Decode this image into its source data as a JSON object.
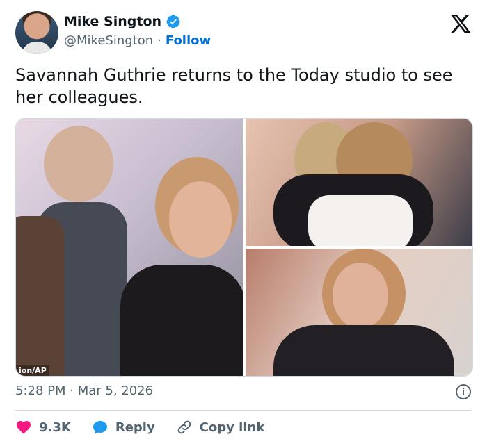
{
  "author": {
    "name": "Mike Sington",
    "handle": "@MikeSington",
    "separator": "·",
    "follow_label": "Follow"
  },
  "tweet": {
    "text": "Savannah Guthrie returns to the Today studio to see her colleagues.",
    "photo_credit": "ion/AP",
    "timestamp": "5:28 PM · Mar 5, 2026"
  },
  "actions": {
    "likes": "9.3K",
    "reply_label": "Reply",
    "copy_link_label": "Copy link"
  },
  "colors": {
    "link": "#006fd6",
    "like": "#f91880",
    "reply": "#1d9bf0",
    "verified": "#1d9bf0",
    "muted": "#536471"
  }
}
